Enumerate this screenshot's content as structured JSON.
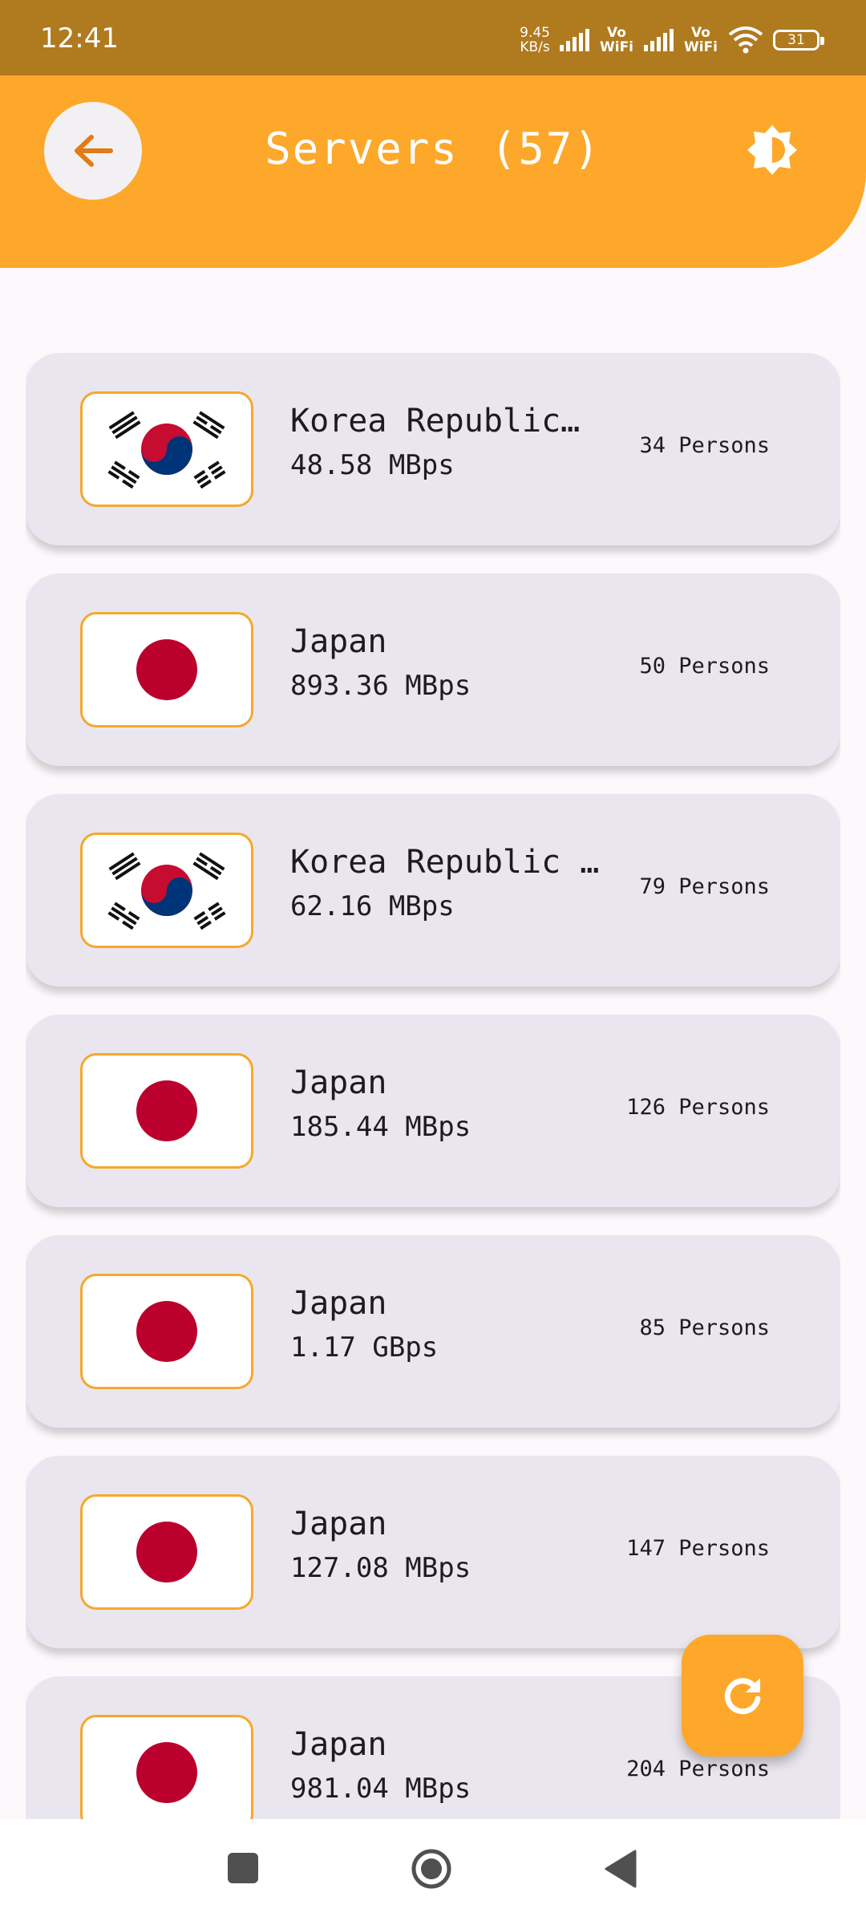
{
  "status_bar": {
    "time": "12:41",
    "speed_value": "9.45",
    "speed_unit": "KB/s",
    "vowifi_1": "Vo WiFi",
    "vowifi_2": "Vo WiFi",
    "battery": "31"
  },
  "header": {
    "title": "Servers",
    "count": "(57)",
    "back_icon": "arrow-left-icon",
    "theme_icon": "brightness-icon"
  },
  "colors": {
    "accent": "#fda82a",
    "status_bar": "#b07a1e",
    "card_bg": "#eae6ef",
    "korea_red": "#c60c30",
    "korea_blue": "#003478",
    "japan_red": "#bc002d"
  },
  "servers": [
    {
      "country": "Korea Republic…",
      "speed": "48.58 MBps",
      "persons": "34 Persons",
      "flag": "korea"
    },
    {
      "country": "Japan",
      "speed": "893.36 MBps",
      "persons": "50 Persons",
      "flag": "japan"
    },
    {
      "country": "Korea Republic …",
      "speed": "62.16 MBps",
      "persons": "79 Persons",
      "flag": "korea"
    },
    {
      "country": "Japan",
      "speed": "185.44 MBps",
      "persons": "126 Persons",
      "flag": "japan"
    },
    {
      "country": "Japan",
      "speed": "1.17 GBps",
      "persons": "85 Persons",
      "flag": "japan"
    },
    {
      "country": "Japan",
      "speed": "127.08 MBps",
      "persons": "147 Persons",
      "flag": "japan"
    },
    {
      "country": "Japan",
      "speed": "981.04 MBps",
      "persons": "204 Persons",
      "flag": "japan"
    }
  ],
  "fab": {
    "icon": "refresh-icon"
  },
  "nav": {
    "recents": "recents-icon",
    "home": "home-icon",
    "back": "back-triangle-icon"
  }
}
